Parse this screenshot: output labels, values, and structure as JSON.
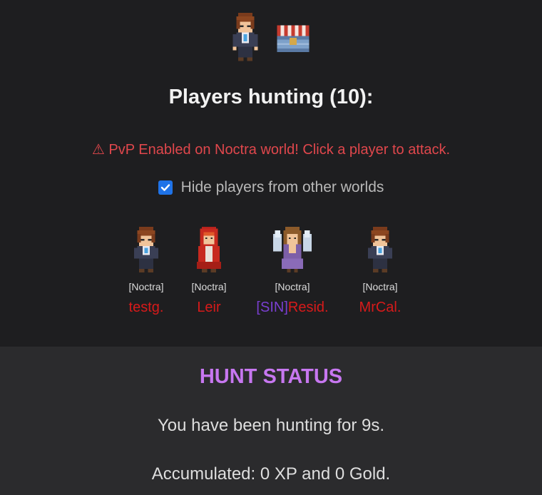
{
  "header": {
    "sprites": [
      "player-avatar-icon",
      "treasure-chest-icon"
    ],
    "title": "Players hunting (10):",
    "pvp_warning": "⚠ PvP Enabled on Noctra world! Click a player to attack.",
    "hide_checkbox_checked": true,
    "hide_label": "Hide players from other worlds"
  },
  "players": [
    {
      "world": "[Noctra]",
      "guild": "",
      "name": "testg.",
      "sprite": "brown-hair-hero-icon"
    },
    {
      "world": "[Noctra]",
      "guild": "",
      "name": "Leir",
      "sprite": "red-hooded-mage-icon"
    },
    {
      "world": "[Noctra]",
      "guild": "[SIN]",
      "name": "Resid.",
      "sprite": "winged-angel-icon"
    },
    {
      "world": "[Noctra]",
      "guild": "",
      "name": "MrCal.",
      "sprite": "brown-hair-hero-icon"
    }
  ],
  "colors": {
    "pvp_warning": "#e0474c",
    "player_name": "#d71a1a",
    "guild_tag": "#7a3fd0",
    "hunt_title": "#c777f0",
    "checkbox": "#1f73e8"
  },
  "hunt_status": {
    "title": "HUNT STATUS",
    "duration_text": "You have been hunting for 9s.",
    "accumulated_text": "Accumulated: 0 XP and 0 Gold."
  }
}
